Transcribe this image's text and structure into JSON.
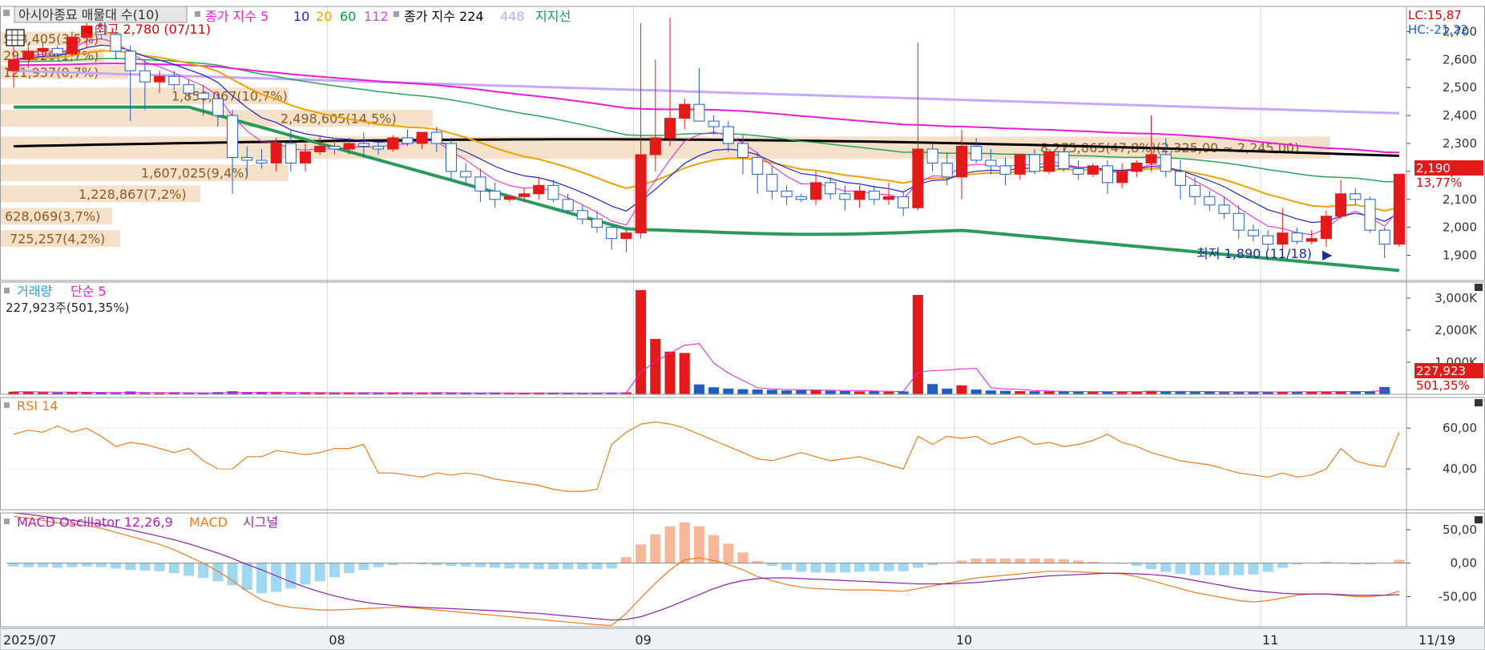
{
  "legend": {
    "main_title": "아시아종묘 매물대 수(10)",
    "ma_label": "종가 지수 5",
    "ma_periods": [
      "10",
      "20",
      "60",
      "112"
    ],
    "ma224_label": "종가 지수 224",
    "ma448_label": "448",
    "support_label": "지지선",
    "volume_title": "거래량",
    "volume_ma": "단순 5",
    "volume_value": "227,923주(501,35%)",
    "rsi_title": "RSI 14",
    "macd_title": "MACD Oscillator 12,26,9",
    "macd_label": "MACD",
    "signal_label": "시그널"
  },
  "corner": {
    "lc": "LC:15,87",
    "hc": "HC:-21,22"
  },
  "markers": {
    "high": "최고 2,780 (07/11)",
    "low": "최저 1,890 (11/18)",
    "last_price": "2,190",
    "last_change": "13,77%",
    "last_volume": "227,923",
    "last_volume_pct": "501,35%"
  },
  "volume_profile": [
    {
      "label": "533,405(3,5%)",
      "lo": 2650,
      "hi": 2700
    },
    {
      "label": "297,029(1,7%)",
      "lo": 2590,
      "hi": 2640
    },
    {
      "label": "121,937(0,7%)",
      "lo": 2530,
      "hi": 2580
    },
    {
      "label": "1,850,067(10,7%)",
      "lo": 2440,
      "hi": 2500
    },
    {
      "label": "2,498,605(14,5%)",
      "lo": 2360,
      "hi": 2420
    },
    {
      "label": "8,275,865(47,8%)(2,325,00 ~ 2,245,00)",
      "lo": 2245,
      "hi": 2325
    },
    {
      "label": "1,607,025(9,4%)",
      "lo": 2165,
      "hi": 2225
    },
    {
      "label": "1,228,867(7,2%)",
      "lo": 2090,
      "hi": 2150
    },
    {
      "label": "628,069(3,7%)",
      "lo": 2010,
      "hi": 2070
    },
    {
      "label": "725,257(4,2%)",
      "lo": 1930,
      "hi": 1990
    }
  ],
  "chart_data": {
    "type": "candlestick",
    "x_labels": [
      "2025/07",
      "08",
      "09",
      "10",
      "11",
      "11/19"
    ],
    "price_axis": {
      "ticks": [
        "2,700",
        "2,600",
        "2,500",
        "2,400",
        "2,300",
        "2,200",
        "2,100",
        "2,000",
        "1,900"
      ],
      "range": [
        1810,
        2790
      ]
    },
    "volume_axis": {
      "ticks": [
        "3,000K",
        "2,000K",
        "1,000K"
      ],
      "range": [
        0,
        3500
      ]
    },
    "rsi_axis": {
      "ticks": [
        "60,00",
        "40,00"
      ],
      "range": [
        20,
        75
      ]
    },
    "macd_axis": {
      "ticks": [
        "50,00",
        "0,00",
        "-50,00"
      ],
      "range": [
        -95,
        75
      ]
    },
    "candles": [
      [
        2560,
        2650,
        2500,
        2600
      ],
      [
        2600,
        2660,
        2570,
        2630
      ],
      [
        2630,
        2660,
        2600,
        2640
      ],
      [
        2640,
        2650,
        2610,
        2620
      ],
      [
        2620,
        2700,
        2610,
        2680
      ],
      [
        2680,
        2780,
        2640,
        2720
      ],
      [
        2720,
        2760,
        2670,
        2690
      ],
      [
        2690,
        2700,
        2600,
        2630
      ],
      [
        2630,
        2650,
        2380,
        2560
      ],
      [
        2560,
        2600,
        2420,
        2520
      ],
      [
        2520,
        2560,
        2480,
        2540
      ],
      [
        2540,
        2560,
        2490,
        2510
      ],
      [
        2510,
        2530,
        2460,
        2480
      ],
      [
        2480,
        2510,
        2400,
        2460
      ],
      [
        2460,
        2480,
        2360,
        2400
      ],
      [
        2400,
        2420,
        2120,
        2250
      ],
      [
        2250,
        2290,
        2180,
        2240
      ],
      [
        2240,
        2280,
        2210,
        2230
      ],
      [
        2230,
        2320,
        2200,
        2300
      ],
      [
        2300,
        2350,
        2200,
        2230
      ],
      [
        2230,
        2300,
        2200,
        2270
      ],
      [
        2270,
        2330,
        2260,
        2290
      ],
      [
        2290,
        2310,
        2260,
        2280
      ],
      [
        2280,
        2320,
        2260,
        2300
      ],
      [
        2300,
        2340,
        2250,
        2290
      ],
      [
        2290,
        2310,
        2260,
        2280
      ],
      [
        2280,
        2330,
        2270,
        2320
      ],
      [
        2320,
        2350,
        2290,
        2300
      ],
      [
        2300,
        2340,
        2280,
        2340
      ],
      [
        2340,
        2360,
        2270,
        2300
      ],
      [
        2300,
        2320,
        2170,
        2200
      ],
      [
        2200,
        2230,
        2150,
        2180
      ],
      [
        2180,
        2210,
        2090,
        2130
      ],
      [
        2130,
        2160,
        2070,
        2100
      ],
      [
        2100,
        2110,
        2090,
        2110
      ],
      [
        2110,
        2140,
        2090,
        2120
      ],
      [
        2120,
        2180,
        2100,
        2150
      ],
      [
        2150,
        2170,
        2090,
        2100
      ],
      [
        2100,
        2120,
        2050,
        2060
      ],
      [
        2060,
        2080,
        2010,
        2030
      ],
      [
        2030,
        2060,
        1980,
        2000
      ],
      [
        2000,
        2010,
        1920,
        1960
      ],
      [
        1960,
        1990,
        1910,
        1980
      ],
      [
        1980,
        2730,
        1960,
        2260
      ],
      [
        2260,
        2600,
        2200,
        2320
      ],
      [
        2320,
        2750,
        2290,
        2390
      ],
      [
        2390,
        2460,
        2350,
        2440
      ],
      [
        2440,
        2570,
        2380,
        2380
      ],
      [
        2380,
        2400,
        2330,
        2360
      ],
      [
        2360,
        2380,
        2270,
        2300
      ],
      [
        2300,
        2330,
        2190,
        2250
      ],
      [
        2250,
        2270,
        2120,
        2190
      ],
      [
        2190,
        2220,
        2100,
        2130
      ],
      [
        2130,
        2150,
        2080,
        2110
      ],
      [
        2110,
        2120,
        2090,
        2100
      ],
      [
        2100,
        2200,
        2080,
        2160
      ],
      [
        2160,
        2180,
        2100,
        2120
      ],
      [
        2120,
        2150,
        2060,
        2100
      ],
      [
        2100,
        2150,
        2070,
        2130
      ],
      [
        2130,
        2150,
        2080,
        2100
      ],
      [
        2100,
        2160,
        2080,
        2110
      ],
      [
        2110,
        2130,
        2040,
        2070
      ],
      [
        2070,
        2660,
        2060,
        2280
      ],
      [
        2280,
        2300,
        2200,
        2230
      ],
      [
        2230,
        2270,
        2150,
        2180
      ],
      [
        2180,
        2350,
        2100,
        2290
      ],
      [
        2290,
        2320,
        2230,
        2240
      ],
      [
        2240,
        2280,
        2190,
        2220
      ],
      [
        2220,
        2250,
        2150,
        2190
      ],
      [
        2190,
        2260,
        2170,
        2260
      ],
      [
        2260,
        2280,
        2190,
        2200
      ],
      [
        2200,
        2280,
        2190,
        2270
      ],
      [
        2270,
        2290,
        2200,
        2210
      ],
      [
        2210,
        2240,
        2170,
        2190
      ],
      [
        2190,
        2230,
        2180,
        2220
      ],
      [
        2220,
        2240,
        2120,
        2160
      ],
      [
        2160,
        2230,
        2140,
        2200
      ],
      [
        2200,
        2240,
        2180,
        2230
      ],
      [
        2230,
        2400,
        2200,
        2260
      ],
      [
        2260,
        2320,
        2180,
        2200
      ],
      [
        2200,
        2240,
        2100,
        2150
      ],
      [
        2150,
        2180,
        2080,
        2110
      ],
      [
        2110,
        2130,
        2060,
        2080
      ],
      [
        2080,
        2110,
        2030,
        2050
      ],
      [
        2050,
        2080,
        1960,
        1990
      ],
      [
        1990,
        2010,
        1950,
        1970
      ],
      [
        1970,
        1990,
        1920,
        1940
      ],
      [
        1940,
        2070,
        1920,
        1980
      ],
      [
        1980,
        2000,
        1940,
        1950
      ],
      [
        1950,
        1990,
        1940,
        1960
      ],
      [
        1960,
        2060,
        1930,
        2040
      ],
      [
        2040,
        2170,
        2030,
        2120
      ],
      [
        2120,
        2140,
        2080,
        2100
      ],
      [
        2100,
        2110,
        1980,
        1990
      ],
      [
        1990,
        2000,
        1890,
        1940
      ],
      [
        1940,
        2190,
        1930,
        2190
      ]
    ],
    "volume": [
      80,
      85,
      60,
      55,
      70,
      60,
      50,
      45,
      90,
      40,
      38,
      52,
      36,
      42,
      70,
      95,
      60,
      55,
      48,
      40,
      65,
      50,
      45,
      52,
      42,
      55,
      50,
      48,
      44,
      60,
      46,
      38,
      42,
      50,
      40,
      36,
      44,
      48,
      40,
      38,
      45,
      55,
      62,
      3250,
      1730,
      1330,
      1290,
      310,
      220,
      180,
      160,
      150,
      140,
      120,
      130,
      140,
      110,
      100,
      90,
      95,
      80,
      90,
      3100,
      320,
      180,
      280,
      150,
      120,
      110,
      100,
      95,
      90,
      85,
      80,
      80,
      85,
      90,
      80,
      110,
      90,
      85,
      80,
      75,
      70,
      80,
      85,
      70,
      75,
      80,
      85,
      90,
      95,
      90,
      85,
      228
    ],
    "rsi": [
      57,
      59,
      58,
      61,
      58,
      60,
      56,
      51,
      53,
      52,
      50,
      48,
      50,
      44,
      40,
      40,
      46,
      46,
      49,
      48,
      47,
      48,
      50,
      50,
      52,
      38,
      38,
      37,
      36,
      38,
      37,
      38,
      37,
      35,
      34,
      33,
      32,
      30,
      29,
      29,
      30,
      52,
      58,
      62,
      63,
      62,
      60,
      57,
      54,
      51,
      48,
      45,
      44,
      46,
      48,
      46,
      44,
      45,
      46,
      44,
      42,
      40,
      56,
      52,
      56,
      55,
      56,
      52,
      54,
      56,
      52,
      53,
      51,
      52,
      54,
      57,
      53,
      51,
      48,
      46,
      44,
      43,
      42,
      40,
      38,
      37,
      36,
      38,
      36,
      37,
      40,
      50,
      44,
      42,
      41,
      58
    ],
    "macd": [
      70,
      67,
      64,
      60,
      58,
      56,
      52,
      46,
      40,
      34,
      28,
      20,
      10,
      0,
      -12,
      -26,
      -42,
      -55,
      -62,
      -66,
      -68,
      -70,
      -70,
      -69,
      -68,
      -67,
      -66,
      -66,
      -68,
      -70,
      -72,
      -74,
      -76,
      -78,
      -80,
      -82,
      -84,
      -86,
      -88,
      -90,
      -92,
      -93,
      -75,
      -52,
      -30,
      -10,
      5,
      8,
      4,
      -2,
      -10,
      -20,
      -26,
      -32,
      -36,
      -38,
      -39,
      -40,
      -40,
      -40,
      -41,
      -42,
      -38,
      -34,
      -30,
      -26,
      -22,
      -20,
      -18,
      -16,
      -14,
      -12,
      -12,
      -13,
      -14,
      -15,
      -16,
      -20,
      -26,
      -32,
      -38,
      -44,
      -48,
      -52,
      -56,
      -58,
      -56,
      -52,
      -48,
      -46,
      -46,
      -48,
      -50,
      -50,
      -48,
      -42
    ],
    "signal": [
      75,
      73,
      70,
      67,
      64,
      61,
      58,
      54,
      50,
      45,
      40,
      35,
      29,
      22,
      15,
      7,
      -2,
      -10,
      -19,
      -28,
      -36,
      -43,
      -49,
      -54,
      -58,
      -61,
      -63,
      -65,
      -66,
      -67,
      -68,
      -69,
      -70,
      -71,
      -72,
      -74,
      -75,
      -77,
      -79,
      -81,
      -83,
      -85,
      -84,
      -80,
      -73,
      -65,
      -56,
      -47,
      -38,
      -31,
      -26,
      -23,
      -22,
      -22,
      -23,
      -24,
      -25,
      -26,
      -27,
      -28,
      -29,
      -30,
      -31,
      -31,
      -31,
      -30,
      -29,
      -27,
      -25,
      -23,
      -21,
      -19,
      -18,
      -17,
      -16,
      -15,
      -15,
      -16,
      -17,
      -19,
      -22,
      -26,
      -30,
      -34,
      -38,
      -41,
      -43,
      -45,
      -46,
      -46,
      -46,
      -47,
      -48,
      -48,
      -48,
      -47
    ],
    "osc": [
      -5,
      -6,
      -6,
      -7,
      -6,
      -5,
      -6,
      -8,
      -10,
      -11,
      -12,
      -15,
      -19,
      -22,
      -27,
      -33,
      -40,
      -45,
      -43,
      -38,
      -32,
      -27,
      -21,
      -15,
      -10,
      -6,
      -3,
      -1,
      -2,
      -3,
      -4,
      -5,
      -6,
      -7,
      -8,
      -8,
      -9,
      -9,
      -9,
      -9,
      -9,
      -8,
      9,
      28,
      43,
      55,
      61,
      55,
      42,
      29,
      16,
      3,
      -4,
      -10,
      -13,
      -14,
      -14,
      -14,
      -13,
      -12,
      -12,
      -12,
      -7,
      -3,
      1,
      4,
      7,
      7,
      7,
      7,
      7,
      7,
      6,
      4,
      2,
      0,
      -1,
      -4,
      -9,
      -13,
      -16,
      -18,
      -18,
      -18,
      -18,
      -17,
      -13,
      -7,
      -2,
      0,
      2,
      1,
      -2,
      -2,
      0,
      5
    ]
  }
}
